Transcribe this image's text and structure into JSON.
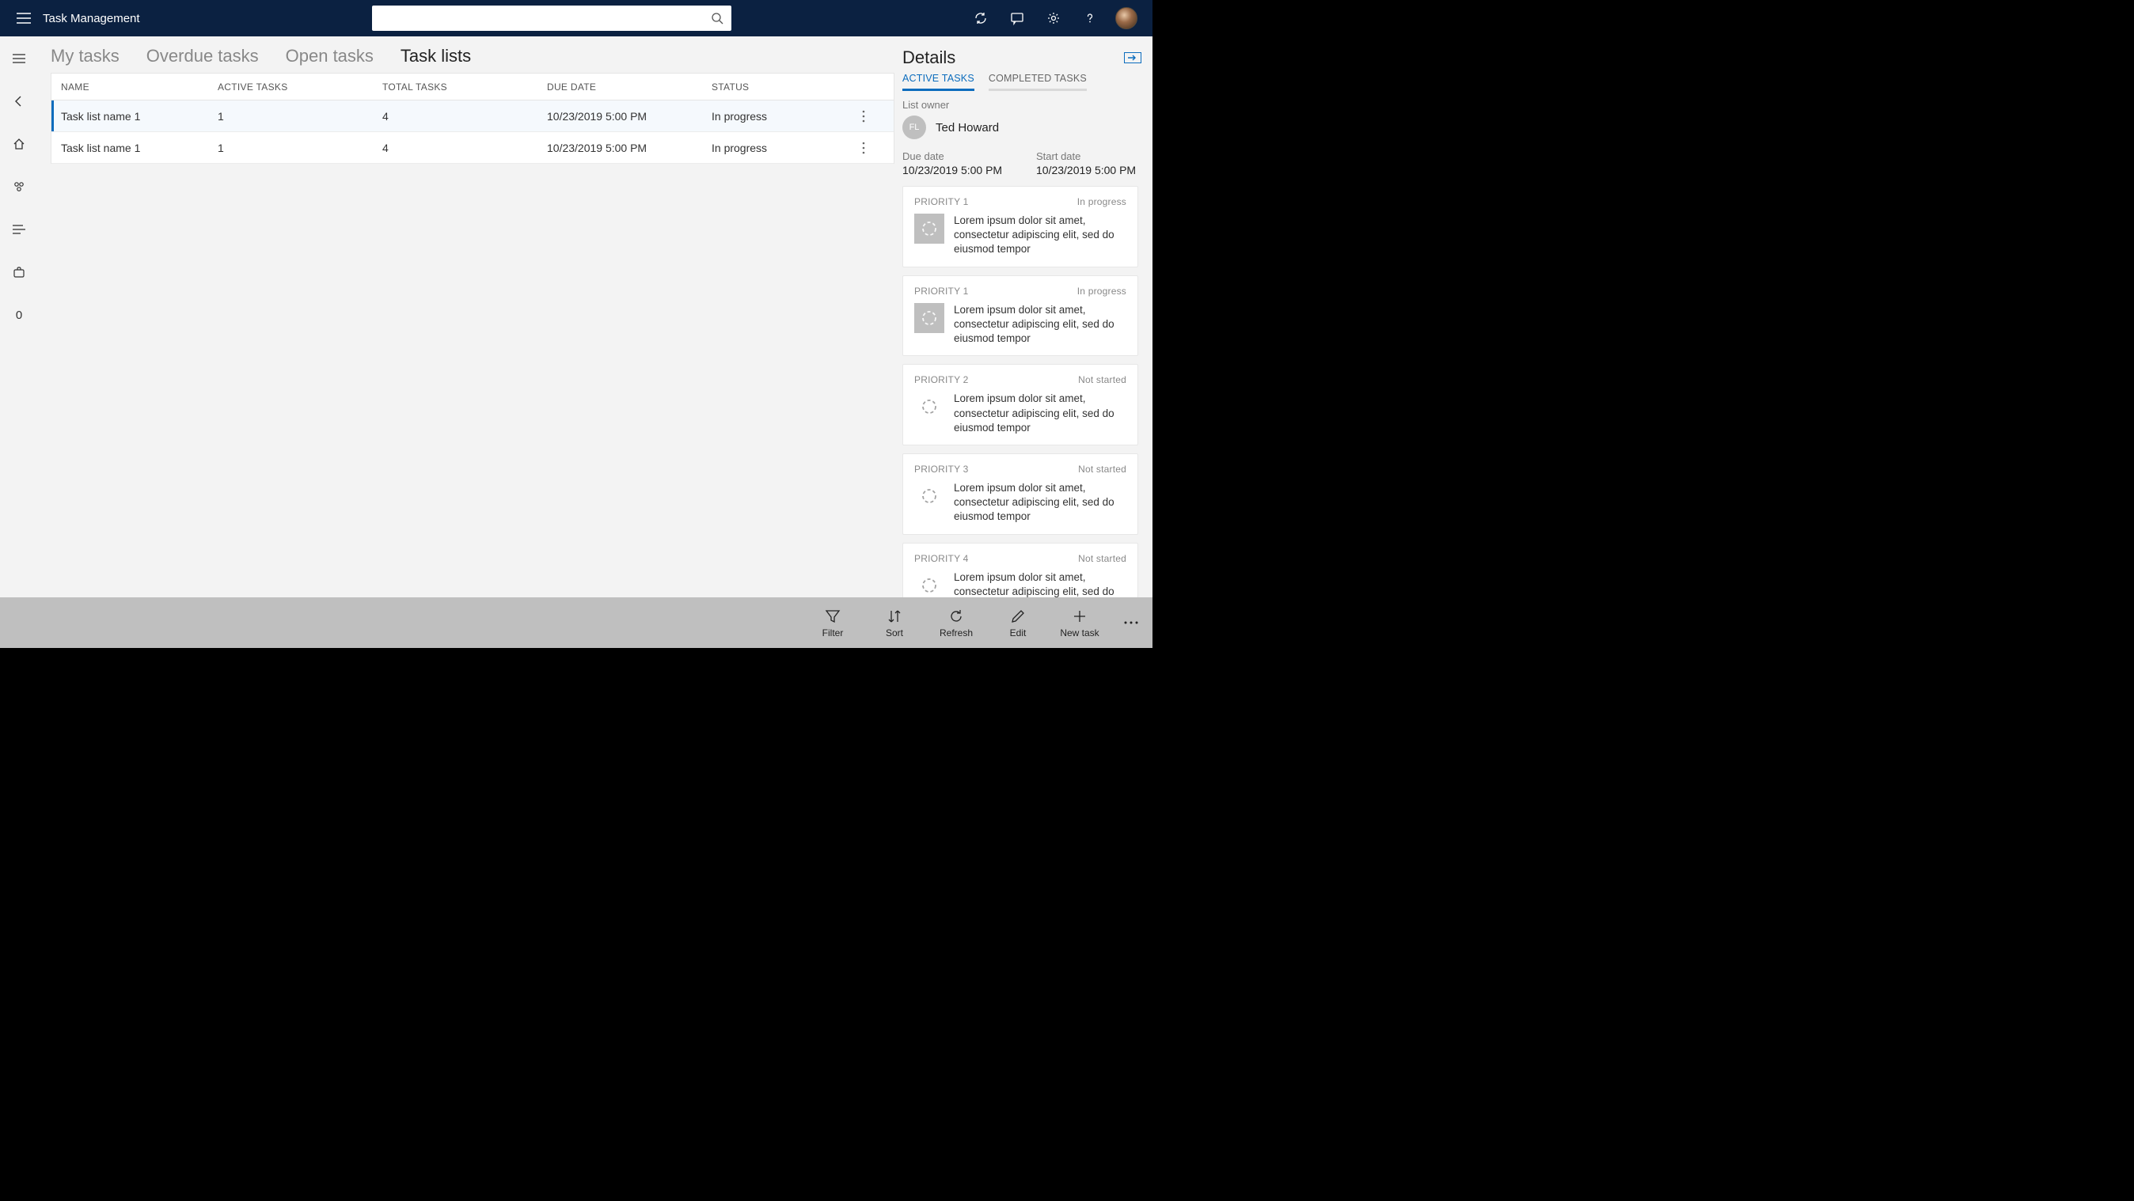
{
  "app": {
    "title": "Task Management"
  },
  "search": {
    "placeholder": ""
  },
  "tabs": {
    "my": "My tasks",
    "overdue": "Overdue tasks",
    "open": "Open tasks",
    "lists": "Task lists"
  },
  "grid": {
    "headers": {
      "name": "NAME",
      "active": "ACTIVE TASKS",
      "total": "TOTAL TASKS",
      "due": "DUE DATE",
      "status": "STATUS"
    },
    "rows": [
      {
        "name": "Task list name 1",
        "active": "1",
        "total": "4",
        "due": "10/23/2019 5:00 PM",
        "status": "In progress"
      },
      {
        "name": "Task list name 1",
        "active": "1",
        "total": "4",
        "due": "10/23/2019 5:00 PM",
        "status": "In progress"
      }
    ]
  },
  "details": {
    "title": "Details",
    "tabs": {
      "active": "ACTIVE TASKS",
      "completed": "COMPLETED TASKS"
    },
    "owner_label": "List owner",
    "owner_initials": "FL",
    "owner_name": "Ted Howard",
    "due_label": "Due date",
    "due_value": "10/23/2019 5:00 PM",
    "start_label": "Start date",
    "start_value": "10/23/2019 5:00 PM",
    "cards": [
      {
        "priority": "PRIORITY 1",
        "status": "In progress",
        "desc": "Lorem ipsum dolor sit amet, consectetur adipiscing elit, sed do eiusmod tempor",
        "filled": true
      },
      {
        "priority": "PRIORITY 1",
        "status": "In progress",
        "desc": "Lorem ipsum dolor sit amet, consectetur adipiscing elit, sed do eiusmod tempor",
        "filled": true
      },
      {
        "priority": "PRIORITY 2",
        "status": "Not started",
        "desc": "Lorem ipsum dolor sit amet, consectetur adipiscing elit, sed do eiusmod tempor",
        "filled": false
      },
      {
        "priority": "PRIORITY 3",
        "status": "Not started",
        "desc": "Lorem ipsum dolor sit amet, consectetur adipiscing elit, sed do eiusmod tempor",
        "filled": false
      },
      {
        "priority": "PRIORITY 4",
        "status": "Not started",
        "desc": "Lorem ipsum dolor sit amet, consectetur adipiscing elit, sed do eiusmod tempor",
        "filled": false
      }
    ]
  },
  "cmd": {
    "filter": "Filter",
    "sort": "Sort",
    "refresh": "Refresh",
    "edit": "Edit",
    "newtask": "New task"
  },
  "rail": {
    "count": "0"
  }
}
